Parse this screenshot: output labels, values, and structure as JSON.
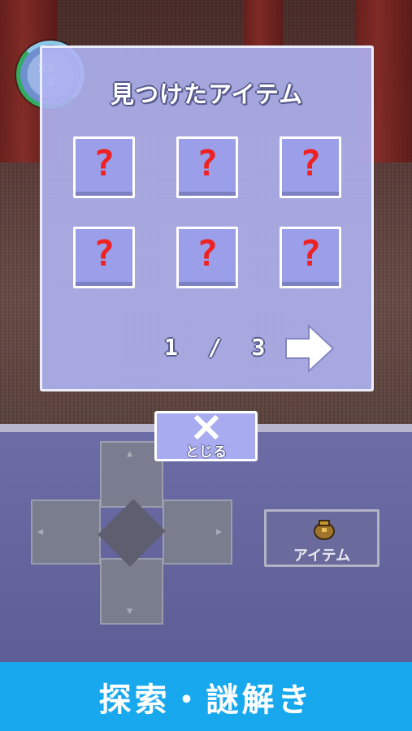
{
  "dialog": {
    "title": "見つけたアイテム",
    "slots": [
      "?",
      "?",
      "?",
      "?",
      "?",
      "?"
    ],
    "page_current": "1",
    "page_separator": "/",
    "page_total": "3"
  },
  "controls": {
    "close_label": "とじる",
    "item_label": "アイテム"
  },
  "banner": {
    "caption": "探索・謎解き"
  },
  "colors": {
    "dialog_bg": "#afb2f2",
    "slot_bg": "#9b9fea",
    "question_mark": "#ee2222",
    "panel_bg": "#6c6ca6",
    "banner_bg": "#17a8ee",
    "status_ring": "#2fae5f"
  },
  "icons": {
    "status": "sleep-zz-icon",
    "next": "right-arrow-icon",
    "close": "x-icon",
    "item": "bag-icon"
  }
}
